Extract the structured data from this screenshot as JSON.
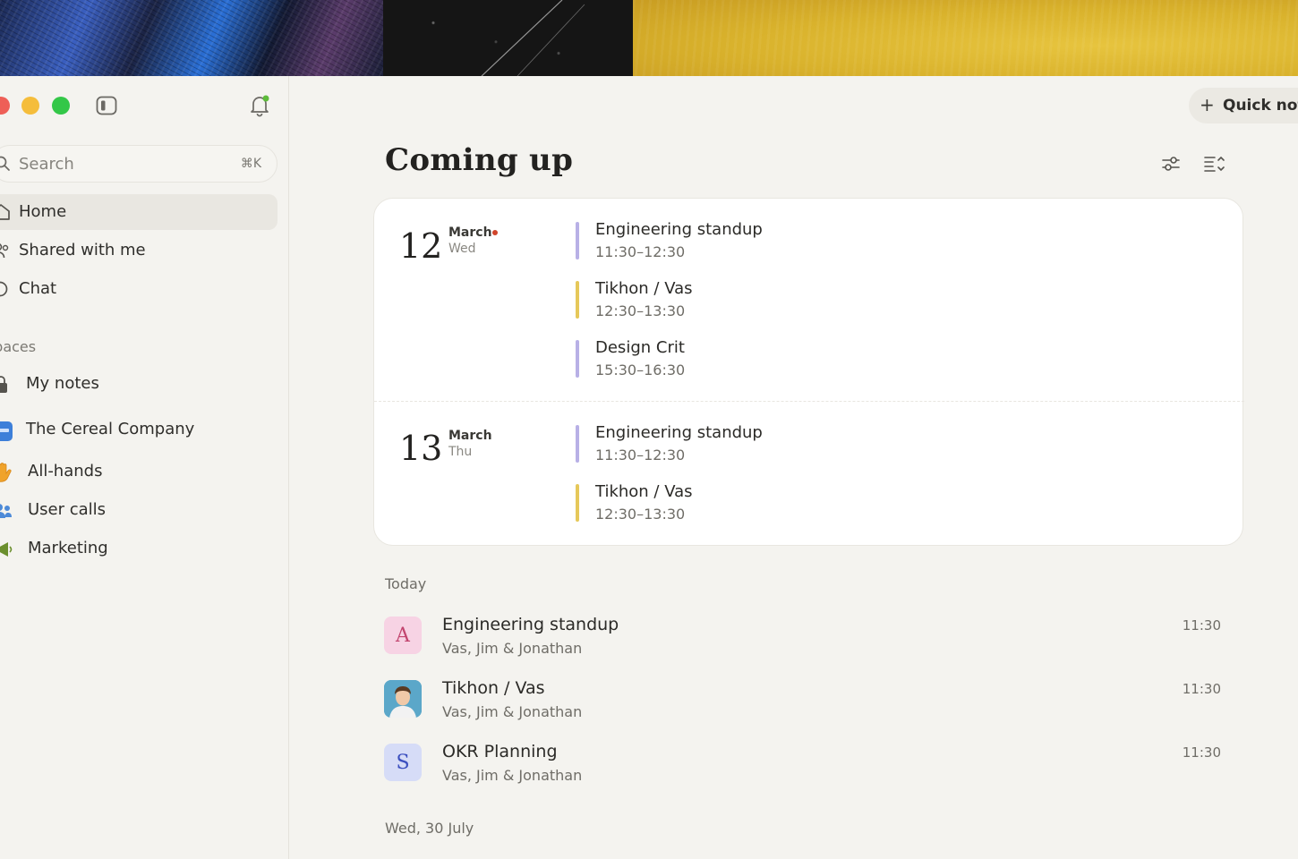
{
  "sidebar": {
    "search": {
      "placeholder": "Search",
      "shortcut": "⌘K"
    },
    "nav": [
      {
        "label": "Home",
        "icon": "home-icon",
        "active": true
      },
      {
        "label": "Shared with me",
        "icon": "shared-icon"
      },
      {
        "label": "Chat",
        "icon": "chat-icon"
      }
    ],
    "spaces_label": "Spaces",
    "spaces": [
      {
        "label": "My notes",
        "icon": "lock-icon"
      },
      {
        "label": "The Cereal Company",
        "icon": "company-logo-icon"
      },
      {
        "label": "All-hands",
        "icon": "raised-hand-icon"
      },
      {
        "label": "User calls",
        "icon": "people-icon"
      },
      {
        "label": "Marketing",
        "icon": "megaphone-icon"
      }
    ]
  },
  "header": {
    "quick_note_label": "Quick note"
  },
  "main": {
    "title": "Coming up",
    "upcoming": [
      {
        "day": "12",
        "month": "March",
        "weekday": "Wed",
        "today_indicator": true,
        "events": [
          {
            "title": "Engineering standup",
            "time": "11:30–12:30",
            "color": "#b8b0e6"
          },
          {
            "title": "Tikhon / Vas",
            "time": "12:30–13:30",
            "color": "#e6c85a"
          },
          {
            "title": "Design Crit",
            "time": "15:30–16:30",
            "color": "#b8b0e6"
          }
        ]
      },
      {
        "day": "13",
        "month": "March",
        "weekday": "Thu",
        "today_indicator": false,
        "events": [
          {
            "title": "Engineering standup",
            "time": "11:30–12:30",
            "color": "#b8b0e6"
          },
          {
            "title": "Tikhon / Vas",
            "time": "12:30–13:30",
            "color": "#e6c85a"
          }
        ]
      }
    ],
    "today_label": "Today",
    "meetings": [
      {
        "title": "Engineering standup",
        "participants": "Vas, Jim & Jonathan",
        "time": "11:30",
        "avatar_letter": "A",
        "avatar_bg": "#f7d3e4",
        "avatar_fg": "#c2456f"
      },
      {
        "title": "Tikhon / Vas",
        "participants": "Vas, Jim & Jonathan",
        "time": "11:30",
        "avatar_letter": "",
        "avatar_bg": "#5ba7c9",
        "avatar_fg": "#ffffff"
      },
      {
        "title": "OKR Planning",
        "participants": "Vas, Jim & Jonathan",
        "time": "11:30",
        "avatar_letter": "S",
        "avatar_bg": "#d6dcf7",
        "avatar_fg": "#3b4fbf"
      }
    ],
    "next_section_label": "Wed, 30 July"
  }
}
